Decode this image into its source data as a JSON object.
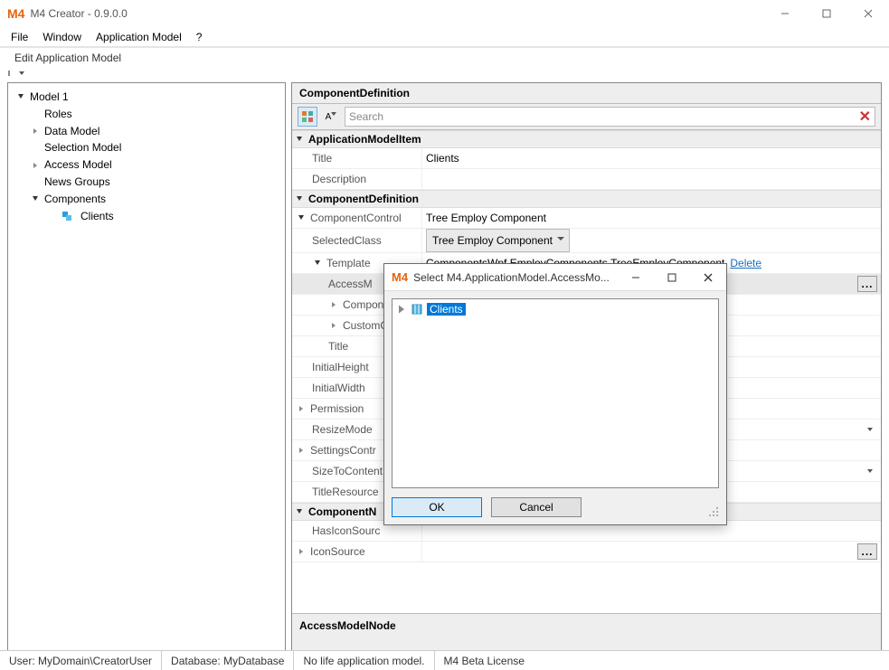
{
  "title": "M4 Creator - 0.9.0.0",
  "menu": [
    "File",
    "Window",
    "Application Model",
    "?"
  ],
  "editHeader": "Edit Application Model",
  "tree": {
    "root": "Model 1",
    "items": [
      {
        "label": "Roles",
        "exp": "leaf"
      },
      {
        "label": "Data Model",
        "exp": "closed"
      },
      {
        "label": "Selection Model",
        "exp": "leaf"
      },
      {
        "label": "Access Model",
        "exp": "closed"
      },
      {
        "label": "News Groups",
        "exp": "leaf"
      },
      {
        "label": "Components",
        "exp": "open"
      }
    ],
    "child": "Clients"
  },
  "pg": {
    "header": "ComponentDefinition",
    "searchPlaceholder": "Search",
    "cats": {
      "appModelItem": "ApplicationModelItem",
      "compDef": "ComponentDefinition",
      "compNode": "ComponentN"
    },
    "props": {
      "title": {
        "name": "Title",
        "value": "Clients"
      },
      "desc": {
        "name": "Description",
        "value": ""
      },
      "compControl": {
        "name": "ComponentControl",
        "value": "Tree Employ Component"
      },
      "selClass": {
        "name": "SelectedClass",
        "value": "Tree Employ Component"
      },
      "template": {
        "name": "Template",
        "value": "ComponentsWpf.EmployComponents.TreeEmployComponent",
        "link": "Delete"
      },
      "accessModel": {
        "name": "AccessM"
      },
      "compon": {
        "name": "Compon"
      },
      "customClass": {
        "name": "CustomCla"
      },
      "titleSub": {
        "name": "Title"
      },
      "initH": {
        "name": "InitialHeight"
      },
      "initW": {
        "name": "InitialWidth"
      },
      "perm": {
        "name": "Permission"
      },
      "resize": {
        "name": "ResizeMode"
      },
      "settings": {
        "name": "SettingsContr"
      },
      "sizeTo": {
        "name": "SizeToContent"
      },
      "titleRes": {
        "name": "TitleResource"
      },
      "hasIcon": {
        "name": "HasIconSourc"
      },
      "iconSrc": {
        "name": "IconSource"
      }
    },
    "desc": "AccessModelNode"
  },
  "dialog": {
    "title": "Select M4.ApplicationModel.AccessMo...",
    "item": "Clients",
    "ok": "OK",
    "cancel": "Cancel"
  },
  "status": {
    "user": "User: MyDomain\\CreatorUser",
    "db": "Database: MyDatabase",
    "life": "No life application model.",
    "lic": "M4 Beta License"
  }
}
